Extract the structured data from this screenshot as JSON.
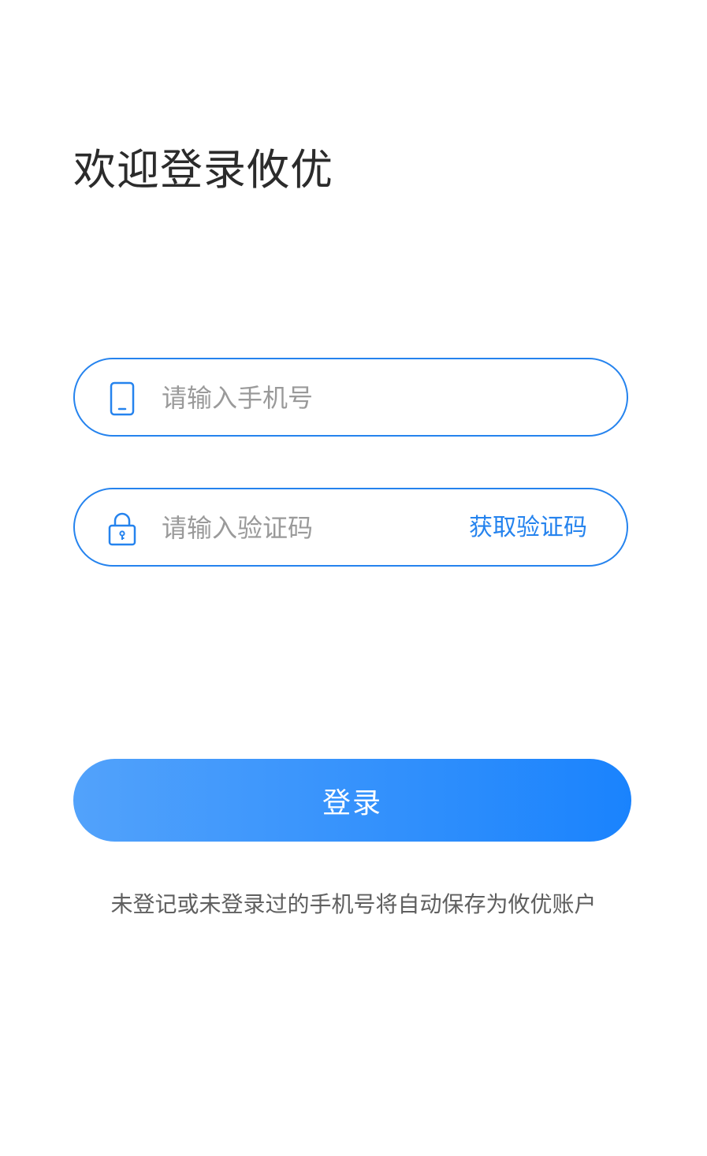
{
  "title": "欢迎登录攸优",
  "phone_field": {
    "icon": "phone-icon",
    "placeholder": "请输入手机号",
    "value": ""
  },
  "code_field": {
    "icon": "lock-icon",
    "placeholder": "请输入验证码",
    "value": "",
    "get_code_label": "获取验证码"
  },
  "login_button": {
    "label": "登录"
  },
  "notice": "未登记或未登录过的手机号将自动保存为攸优账户",
  "colors": {
    "accent": "#2583ee",
    "button_gradient_start": "#52a2fb",
    "button_gradient_end": "#1a83fd",
    "placeholder": "#9a9a9a",
    "title": "#2b2b2b"
  }
}
